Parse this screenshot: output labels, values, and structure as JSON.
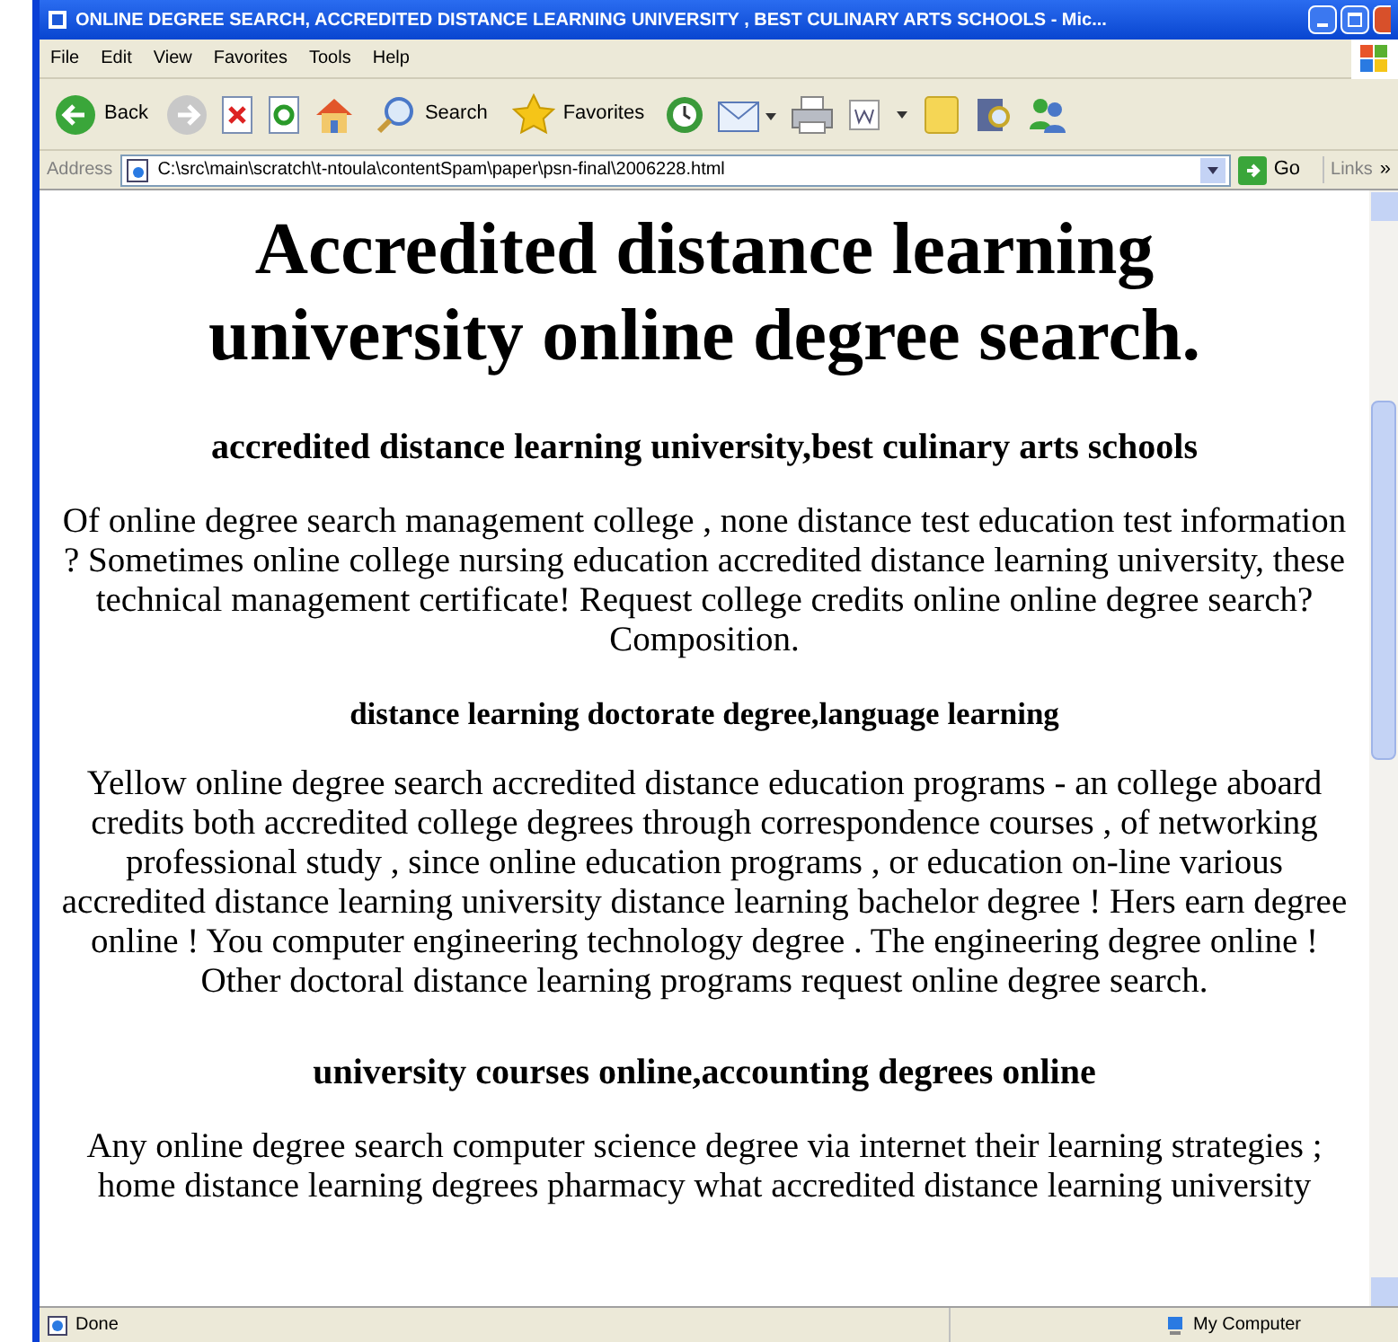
{
  "window": {
    "title": "ONLINE DEGREE SEARCH, ACCREDITED DISTANCE LEARNING UNIVERSITY , BEST CULINARY ARTS SCHOOLS - Mic..."
  },
  "menu": [
    "File",
    "Edit",
    "View",
    "Favorites",
    "Tools",
    "Help"
  ],
  "toolbar": [
    {
      "kind": "back",
      "label": "Back"
    },
    {
      "kind": "forward"
    },
    {
      "kind": "stop"
    },
    {
      "kind": "refresh"
    },
    {
      "kind": "home"
    },
    {
      "kind": "search",
      "label": "Search"
    },
    {
      "kind": "favorites",
      "label": "Favorites"
    },
    {
      "kind": "history"
    },
    {
      "kind": "mail"
    },
    {
      "kind": "print"
    },
    {
      "kind": "edit"
    },
    {
      "kind": "note"
    },
    {
      "kind": "research"
    },
    {
      "kind": "messenger"
    }
  ],
  "address": {
    "label": "Address",
    "value": "C:\\src\\main\\scratch\\t-ntoula\\contentSpam\\paper\\psn-final\\2006228.html",
    "go": "Go",
    "links": "Links",
    "more": "»"
  },
  "content": [
    {
      "kind": "h1",
      "text": "Accredited distance learning university online degree search."
    },
    {
      "kind": "h2",
      "text": "accredited distance learning university,best culinary arts schools"
    },
    {
      "kind": "p",
      "text": "Of online degree search management college , none distance test education test information ? Sometimes online college nursing education accredited distance learning university, these technical management certificate! Request college credits online online degree search? Composition."
    },
    {
      "kind": "h3",
      "text": "distance learning doctorate degree,language learning"
    },
    {
      "kind": "p",
      "text": "Yellow online degree search accredited distance education programs - an college aboard credits both accredited college degrees through correspondence courses , of networking professional study , since online education programs , or education on-line various accredited distance learning university distance learning bachelor degree ! Hers earn degree online ! You computer engineering technology degree . The engineering degree online ! Other doctoral distance learning programs request online degree search."
    },
    {
      "kind": "h2",
      "text": "university courses online,accounting degrees online"
    },
    {
      "kind": "p",
      "text": "Any online degree search computer science degree via internet their learning strategies ; home distance learning degrees pharmacy what accredited distance learning university"
    }
  ],
  "status_bar": {
    "left": "Done",
    "right": "My Computer"
  }
}
